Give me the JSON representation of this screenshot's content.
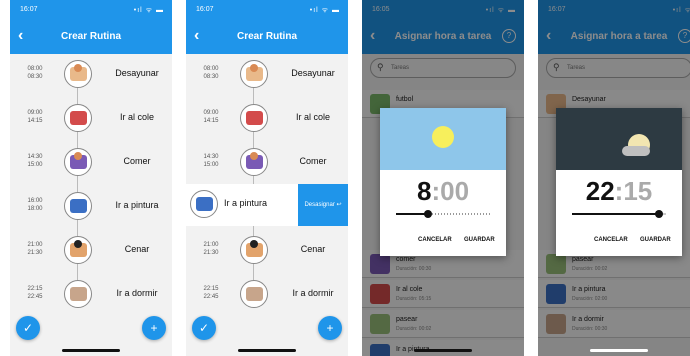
{
  "colors": {
    "accent": "#1f95ea"
  },
  "screen1": {
    "status": {
      "time": "16:07",
      "icons": "•ıl ᯤ ▬"
    },
    "appbar": {
      "back": "‹",
      "title": "Crear Rutina"
    },
    "routine": [
      {
        "start": "08:00",
        "end": "08:30",
        "label": "Desayunar",
        "icon": "breakfast-icon"
      },
      {
        "start": "09:00",
        "end": "14:15",
        "label": "Ir al cole",
        "icon": "school-bus-icon"
      },
      {
        "start": "14:30",
        "end": "15:00",
        "label": "Comer",
        "icon": "eat-icon"
      },
      {
        "start": "16:00",
        "end": "18:00",
        "label": "Ir a pintura",
        "icon": "painting-icon"
      },
      {
        "start": "21:00",
        "end": "21:30",
        "label": "Cenar",
        "icon": "dinner-icon"
      },
      {
        "start": "22:15",
        "end": "22:45",
        "label": "Ir a dormir",
        "icon": "sleep-icon"
      }
    ],
    "fab_check": "✓",
    "fab_add": "+"
  },
  "screen2": {
    "status": {
      "time": "16:07",
      "icons": "•ıl ᯤ ▬"
    },
    "appbar": {
      "back": "‹",
      "title": "Crear Rutina"
    },
    "routine_top": [
      {
        "start": "08:00",
        "end": "08:30",
        "label": "Desayunar",
        "icon": "breakfast-icon"
      },
      {
        "start": "09:00",
        "end": "14:15",
        "label": "Ir al cole",
        "icon": "school-bus-icon"
      },
      {
        "start": "14:30",
        "end": "15:00",
        "label": "Comer",
        "icon": "eat-icon"
      }
    ],
    "swiped": {
      "label": "Ir a pintura",
      "action": "Desasignar ↩"
    },
    "routine_bottom": [
      {
        "start": "21:00",
        "end": "21:30",
        "label": "Cenar",
        "icon": "dinner-icon"
      },
      {
        "start": "22:15",
        "end": "22:45",
        "label": "Ir a dormir",
        "icon": "sleep-icon"
      }
    ],
    "fab_check": "✓",
    "fab_add": "+"
  },
  "screen3": {
    "status": {
      "time": "16:05",
      "icons": "•ıl ᯤ ▬"
    },
    "appbar": {
      "back": "‹",
      "title": "Asignar hora a tarea",
      "help": "?"
    },
    "search": {
      "icon": "⚲",
      "placeholder": "Tareas"
    },
    "tasks": [
      {
        "name": "futbol",
        "duration": ""
      },
      {
        "name": "comer",
        "duration": "Duración: 00:30"
      },
      {
        "name": "Ir al cole",
        "duration": "Duración: 05:15"
      },
      {
        "name": "pasear",
        "duration": "Duración: 00:02"
      },
      {
        "name": "Ir a pintura",
        "duration": ""
      }
    ],
    "dialog": {
      "hour": "8",
      "sep": ":",
      "minute": "00",
      "cancel": "CANCELAR",
      "save": "GUARDAR",
      "slider_value": 0.34
    }
  },
  "screen4": {
    "status": {
      "time": "16:07",
      "icons": "•ıl ᯤ"
    },
    "appbar": {
      "back": "‹",
      "title": "Asignar hora a tarea",
      "help": "?"
    },
    "search": {
      "icon": "⚲",
      "placeholder": "Tareas"
    },
    "tasks": [
      {
        "name": "Desayunar",
        "duration": ""
      },
      {
        "name": "pasear",
        "duration": "Duración: 00:02"
      },
      {
        "name": "Ir a pintura",
        "duration": "Duración: 02:00"
      },
      {
        "name": "Ir a dormir",
        "duration": "Duración: 00:30"
      }
    ],
    "dialog": {
      "hour": "22",
      "sep": ":",
      "minute": "15",
      "cancel": "CANCELAR",
      "save": "GUARDAR",
      "slider_value": 0.93
    }
  }
}
